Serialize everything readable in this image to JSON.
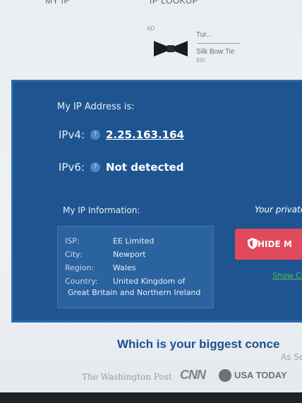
{
  "top_nav": {
    "tab_left": "MY IP",
    "tab_right": "IP LOOKUP"
  },
  "ad": {
    "label": "AD",
    "title_line": "Tur...",
    "product": "Silk Bow Tie",
    "price": "$95"
  },
  "ip_panel": {
    "heading": "My IP Address is:",
    "ipv4_label": "IPv4:",
    "ipv4_value": "2.25.163.164",
    "ipv6_label": "IPv6:",
    "ipv6_value": "Not detected",
    "info_heading": "My IP Information:",
    "info": {
      "isp_label": "ISP:",
      "isp_value": "EE Limited",
      "city_label": "City:",
      "city_value": "Newport",
      "region_label": "Region:",
      "region_value": "Wales",
      "country_label": "Country:",
      "country_value": "United Kingdom of",
      "country_value_cont": "Great Britain and Northern Ireland"
    },
    "private_text": "Your private",
    "hide_button": "HIDE M",
    "show_link": "Show Co"
  },
  "bottom": {
    "question": "Which is your biggest conce",
    "as_seen": "As Se",
    "logos": {
      "wapo": "The Washington Post",
      "cnn": "CNN",
      "usa": "USA TODAY"
    }
  },
  "colors": {
    "panel": "#1e5590",
    "button": "#e04a5c",
    "link_green": "#4bbf5a",
    "question": "#1d4f93"
  }
}
